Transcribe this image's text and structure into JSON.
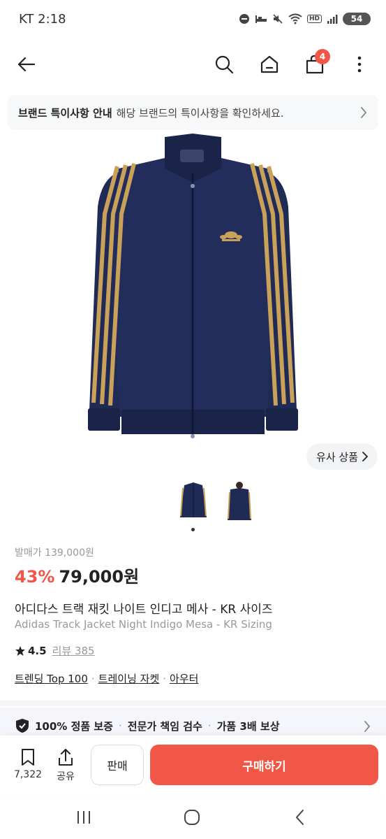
{
  "status_bar": {
    "time": "KT 2:18",
    "hd_label": "HD",
    "battery": "54"
  },
  "header": {
    "cart_count": "4"
  },
  "brand_notice": {
    "title": "브랜드 특이사항 안내",
    "description": "해당 브랜드의 특이사항을 확인하세요."
  },
  "product": {
    "similar_label": "유사 상품",
    "retail_price": "발매가 139,000원",
    "discount": "43%",
    "price": "79,000원",
    "title_ko": "아디다스 트랙 재킷  나이트 인디고 메사 - KR 사이즈",
    "title_en": "Adidas Track Jacket Night Indigo Mesa - KR Sizing",
    "rating": "4.5",
    "review_label": "리뷰 385",
    "tags": [
      "트렌딩 Top 100",
      "트레이닝 자켓",
      "아우터"
    ],
    "colors": {
      "jacket": "#1f2a55",
      "stripe": "#c9a159",
      "accent": "#f15746"
    }
  },
  "guarantee": {
    "items": [
      "100% 정품 보증",
      "전문가 책임 검수",
      "가품 3배 보상"
    ]
  },
  "bottom_bar": {
    "bookmark_count": "7,322",
    "share_label": "공유",
    "sell_label": "판매",
    "buy_label": "구매하기"
  },
  "icons": [
    "back-arrow-icon",
    "search-icon",
    "home-icon",
    "shopping-bag-icon",
    "more-vertical-icon",
    "chevron-right-icon",
    "adidas-trefoil-icon",
    "shield-check-icon",
    "bookmark-icon",
    "share-icon",
    "recent-apps-icon",
    "home-circle-icon",
    "back-chevron-icon"
  ]
}
